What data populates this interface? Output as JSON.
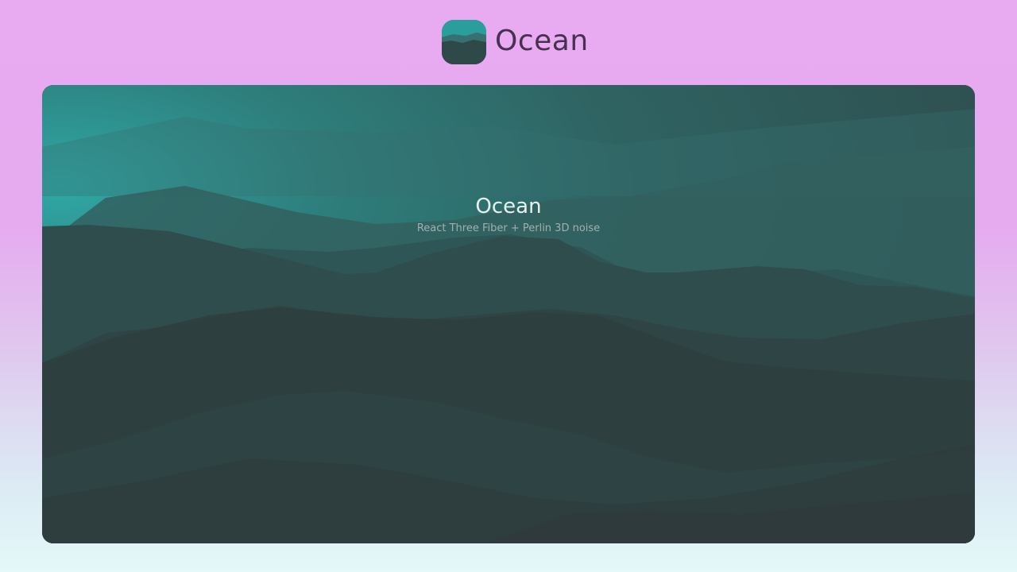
{
  "app": {
    "name": "Ocean",
    "icon": "ocean-landscape-icon"
  },
  "scene": {
    "title": "Ocean",
    "subtitle": "React Three Fiber + Perlin 3D noise"
  },
  "colors": {
    "accent_teal": "#2ea6a3",
    "ridge_dark": "#2f3a3b",
    "title_text": "#46324f",
    "background_top": "#e8aaf0",
    "background_bottom": "#e4f8f8"
  }
}
